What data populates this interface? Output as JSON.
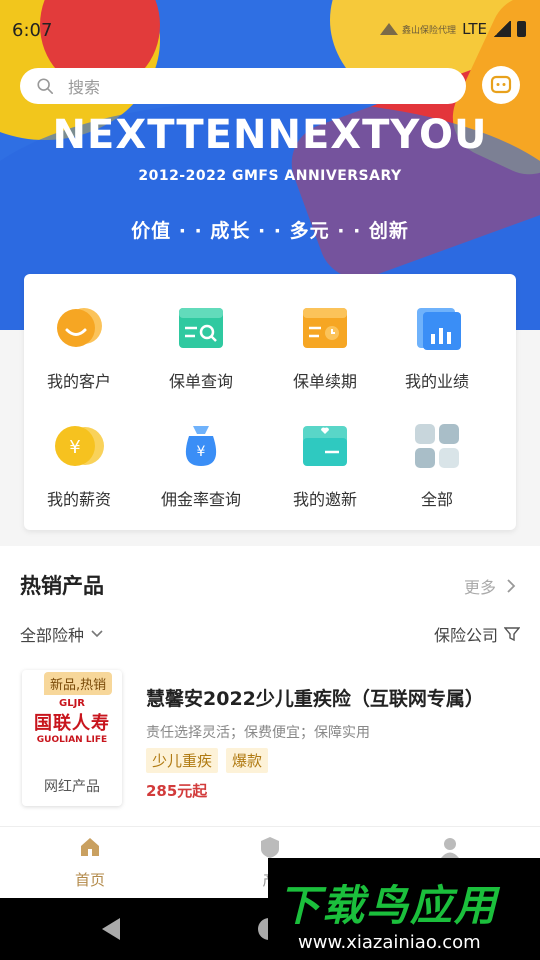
{
  "status": {
    "time": "6:07",
    "network": "LTE",
    "brand_text": "鑫山保险代理"
  },
  "search": {
    "placeholder": "搜索"
  },
  "banner": {
    "headline": "NEXTTENNEXTYOU",
    "subline": "2012-2022 GMFS ANNIVERSARY",
    "slogan": "价值 · · 成长 · · 多元 · · 创新"
  },
  "quick_menu": [
    {
      "label": "我的客户",
      "icon": "customer-icon",
      "color": "#f6a623"
    },
    {
      "label": "保单查询",
      "icon": "policy-search-icon",
      "color": "#2fc9a0"
    },
    {
      "label": "保单续期",
      "icon": "policy-renew-icon",
      "color": "#f6a623"
    },
    {
      "label": "我的业绩",
      "icon": "performance-icon",
      "color": "#3a8ef6"
    },
    {
      "label": "我的薪资",
      "icon": "salary-icon",
      "color": "#f6c21f"
    },
    {
      "label": "佣金率查询",
      "icon": "commission-icon",
      "color": "#3a8ef6"
    },
    {
      "label": "我的邀新",
      "icon": "invite-icon",
      "color": "#2fc9c0"
    },
    {
      "label": "全部",
      "icon": "all-icon",
      "color": "#b8c8d0"
    }
  ],
  "hot": {
    "title": "热销产品",
    "more": "更多",
    "filter_type": "全部险种",
    "filter_company": "保险公司",
    "products": [
      {
        "tag": "新品,热销",
        "logo_abbr": "GLJR",
        "logo_cn": "国联人寿",
        "logo_en": "GUOLIAN LIFE",
        "category": "网红产品",
        "name": "慧馨安2022少儿重疾险（互联网专属）",
        "desc": "责任选择灵活；保费便宜；保障实用",
        "chips": [
          "少儿重疾",
          "爆款"
        ],
        "price": "285元起"
      }
    ]
  },
  "tabs": [
    {
      "label": "首页",
      "icon": "home-icon",
      "active": true
    },
    {
      "label": "产",
      "icon": "product-icon",
      "active": false
    },
    {
      "label": "",
      "icon": "profile-icon",
      "active": false
    }
  ],
  "watermark": {
    "title": "下载鸟应用",
    "url": "www.xiazainiao.com"
  },
  "colors": {
    "accent": "#b38a4a",
    "banner_blue": "#2f6fe3",
    "price_red": "#d23b3b"
  }
}
